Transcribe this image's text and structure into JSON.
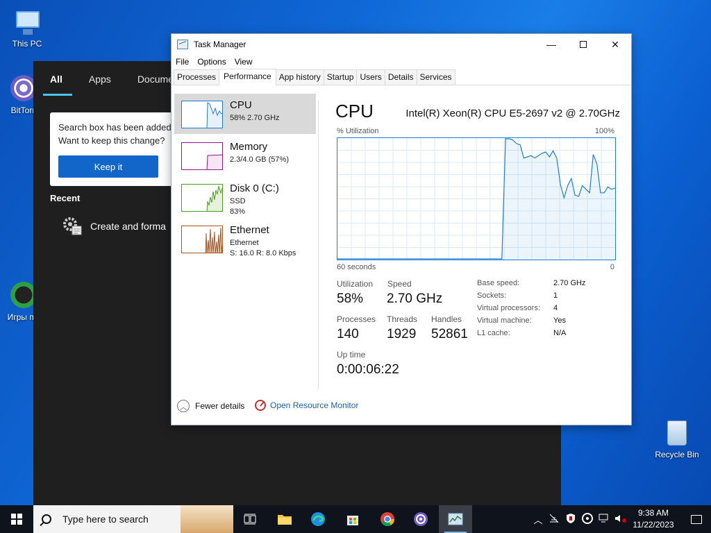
{
  "desktop": {
    "icons": [
      {
        "label": "This PC"
      },
      {
        "label": "BitTorr"
      },
      {
        "label": "Игры по"
      },
      {
        "label": "Recycle Bin"
      }
    ]
  },
  "start_menu": {
    "tabs": [
      "All",
      "Apps",
      "Documents"
    ],
    "notification": {
      "line1": "Search box has been added",
      "line2": "Want to keep this change?",
      "keep_button": "Keep it"
    },
    "recent_heading": "Recent",
    "recent_items": [
      "Create and forma"
    ]
  },
  "task_manager": {
    "title": "Task Manager",
    "menu": [
      "File",
      "Options",
      "View"
    ],
    "tabs": [
      "Processes",
      "Performance",
      "App history",
      "Startup",
      "Users",
      "Details",
      "Services"
    ],
    "active_tab": "Performance",
    "resources": [
      {
        "name": "CPU",
        "sub1": "58%  2.70 GHz",
        "sub2": "",
        "color": "#1b7ed6"
      },
      {
        "name": "Memory",
        "sub1": "2.3/4.0 GB (57%)",
        "sub2": "",
        "color": "#8b1a8b"
      },
      {
        "name": "Disk 0 (C:)",
        "sub1": "SSD",
        "sub2": "83%",
        "color": "#4d9a1f"
      },
      {
        "name": "Ethernet",
        "sub1": "Ethernet",
        "sub2": "S: 16.0  R: 8.0 Kbps",
        "color": "#a7541f"
      }
    ],
    "cpu": {
      "title": "CPU",
      "model": "Intel(R) Xeon(R) CPU E5-2697 v2 @ 2.70GHz",
      "util_label": "% Utilization",
      "max_label": "100%",
      "time_label": "60 seconds",
      "zero_label": "0",
      "utilization_label": "Utilization",
      "utilization": "58%",
      "speed_label": "Speed",
      "speed": "2.70 GHz",
      "processes_label": "Processes",
      "processes": "140",
      "threads_label": "Threads",
      "threads": "1929",
      "handles_label": "Handles",
      "handles": "52861",
      "uptime_label": "Up time",
      "uptime": "0:00:06:22",
      "details": [
        {
          "key": "Base speed:",
          "value": "2.70 GHz"
        },
        {
          "key": "Sockets:",
          "value": "1"
        },
        {
          "key": "Virtual processors:",
          "value": "4"
        },
        {
          "key": "Virtual machine:",
          "value": "Yes"
        },
        {
          "key": "L1 cache:",
          "value": "N/A"
        }
      ],
      "history": [
        0,
        0,
        0,
        0,
        0,
        0,
        0,
        0,
        0,
        0,
        0,
        0,
        0,
        0,
        0,
        0,
        0,
        0,
        0,
        0,
        0,
        0,
        0,
        0,
        0,
        0,
        0,
        0,
        0,
        0,
        0,
        0,
        0,
        0,
        0,
        0,
        0,
        0,
        0,
        0,
        0,
        0,
        0,
        0,
        0,
        0,
        100,
        100,
        99,
        96,
        95,
        84,
        85,
        86,
        84,
        86,
        88,
        89,
        85,
        90,
        84,
        62,
        51,
        61,
        67,
        53,
        52,
        61,
        58,
        55,
        87,
        79,
        55,
        55,
        60,
        58,
        59
      ]
    },
    "footer": {
      "fewer_details": "Fewer details",
      "resource_monitor": "Open Resource Monitor"
    }
  },
  "taskbar": {
    "search_placeholder": "Type here to search",
    "clock_time": "9:38 AM",
    "clock_date": "11/22/2023"
  }
}
